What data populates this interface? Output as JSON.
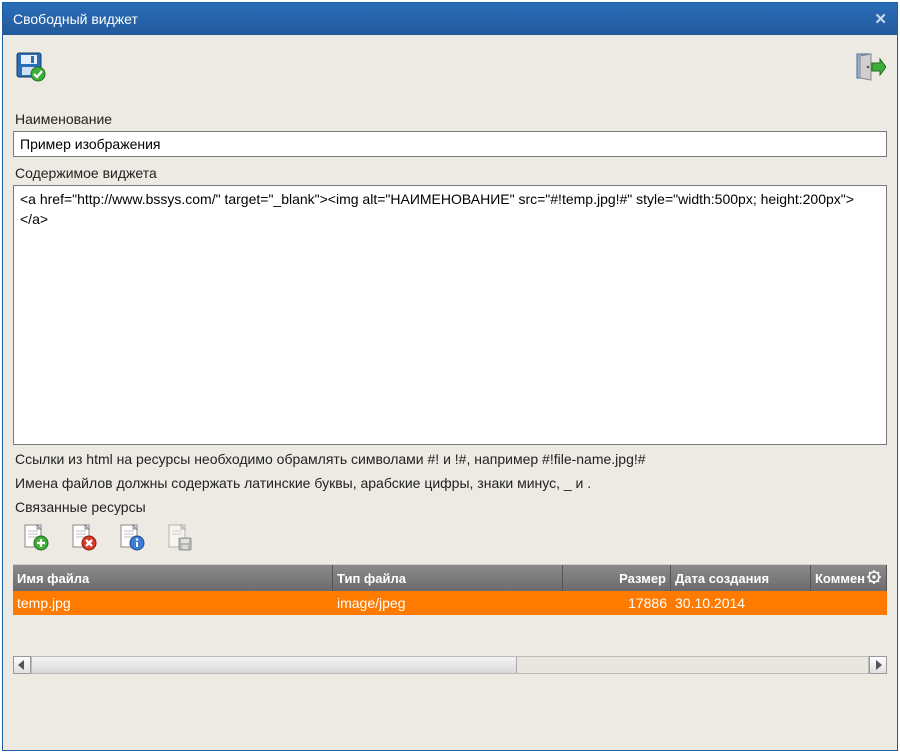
{
  "window": {
    "title": "Свободный виджет"
  },
  "labels": {
    "name": "Наименование",
    "content": "Содержимое виджета",
    "hint1": "Ссылки из html на ресурсы необходимо обрамлять символами #! и !#, например #!file-name.jpg!#",
    "hint2": "Имена файлов должны содержать латинские буквы, арабские цифры, знаки минус, _ и .",
    "resources": "Связанные ресурсы"
  },
  "fields": {
    "name_value": "Пример изображения",
    "content_value": "<a href=\"http://www.bssys.com/\" target=\"_blank\"><img alt=\"НАИМЕНОВАНИЕ\" src=\"#!temp.jpg!#\" style=\"width:500px; height:200px\"></a>"
  },
  "table": {
    "columns": {
      "name": "Имя файла",
      "type": "Тип файла",
      "size": "Размер",
      "date": "Дата создания",
      "comment": "Коммен"
    },
    "rows": [
      {
        "name": "temp.jpg",
        "type": "image/jpeg",
        "size": "17886",
        "date": "30.10.2014",
        "comment": ""
      }
    ]
  }
}
